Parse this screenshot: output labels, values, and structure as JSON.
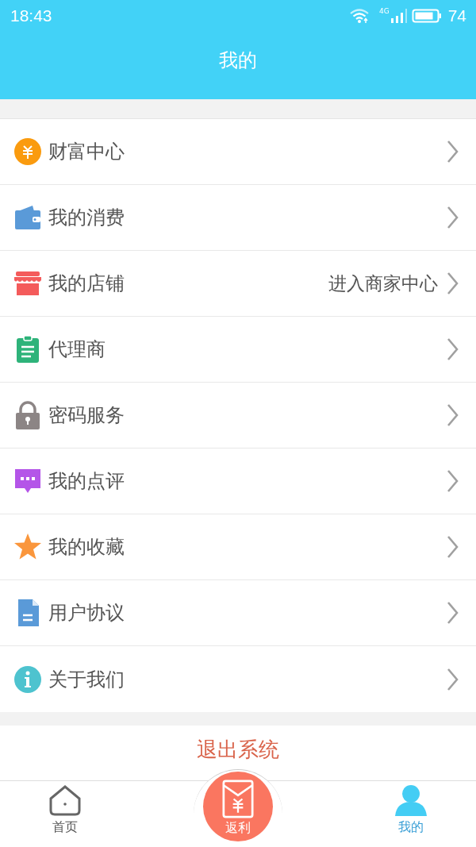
{
  "status_bar": {
    "time": "18:43",
    "network": "4G",
    "battery": "74"
  },
  "header": {
    "title": "我的"
  },
  "menu": [
    {
      "label": "财富中心"
    },
    {
      "label": "我的消费"
    },
    {
      "label": "我的店铺",
      "detail": "进入商家中心"
    },
    {
      "label": "代理商"
    },
    {
      "label": "密码服务"
    },
    {
      "label": "我的点评"
    },
    {
      "label": "我的收藏"
    },
    {
      "label": "用户协议"
    },
    {
      "label": "关于我们"
    }
  ],
  "logout": {
    "label": "退出系统"
  },
  "tab_bar": [
    {
      "label": "首页",
      "kind": "side",
      "selected": false
    },
    {
      "label": "返利",
      "kind": "center",
      "selected": false
    },
    {
      "label": "我的",
      "kind": "side",
      "selected": true
    }
  ]
}
